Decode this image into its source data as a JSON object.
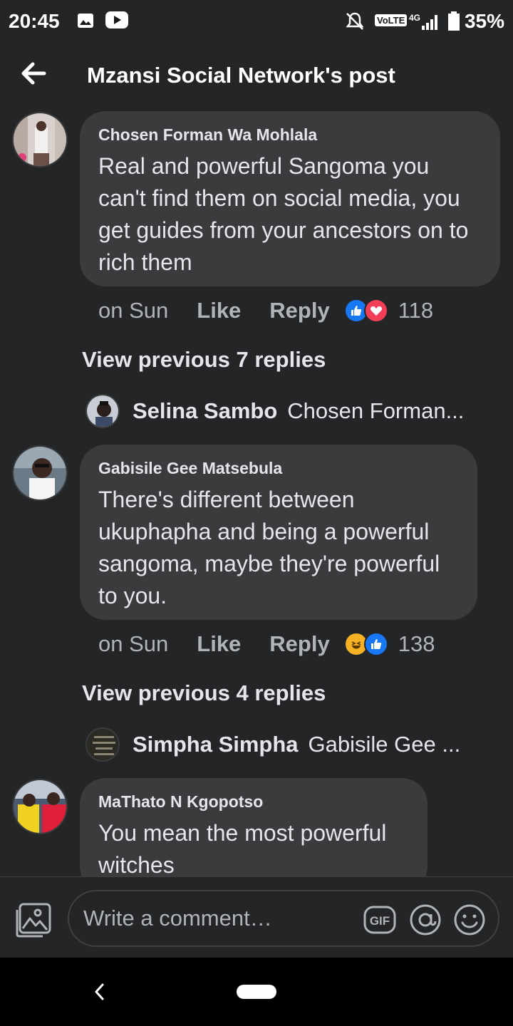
{
  "status_bar": {
    "time": "20:45",
    "battery": "35%",
    "volte": "VoLTE",
    "network": "4G",
    "icons": [
      "gallery-icon",
      "youtube-icon",
      "mute-icon",
      "volte-icon",
      "signal-icon",
      "battery-icon"
    ]
  },
  "header": {
    "title": "Mzansi Social Network's post",
    "back_icon": "arrow-left-icon"
  },
  "comments": [
    {
      "author": "Chosen Forman Wa Mohlala",
      "text": "Real and powerful Sangoma you can't find them on social media, you get guides from your ancestors on to rich them",
      "time": "on Sun",
      "like_label": "Like",
      "reply_label": "Reply",
      "reactions": [
        "like",
        "love"
      ],
      "reaction_count": "118",
      "view_previous": "View previous 7 replies",
      "latest_reply": {
        "name": "Selina Sambo",
        "snippet": "Chosen Forman..."
      }
    },
    {
      "author": "Gabisile Gee Matsebula",
      "text": "There's different between ukuphapha and being a powerful sangoma, maybe they're powerful to you.",
      "time": "on Sun",
      "like_label": "Like",
      "reply_label": "Reply",
      "reactions": [
        "haha",
        "like"
      ],
      "reaction_count": "138",
      "view_previous": "View previous 4 replies",
      "latest_reply": {
        "name": "Simpha Simpha",
        "snippet": "Gabisile Gee ..."
      }
    },
    {
      "author": "MaThato N Kgopotso",
      "text": "You mean the most powerful witches"
    }
  ],
  "composer": {
    "placeholder": "Write a comment…",
    "gif_label": "GIF",
    "icons": [
      "photo-icon",
      "gif-icon",
      "mention-icon",
      "emoji-icon"
    ]
  },
  "colors": {
    "background": "#242526",
    "bubble": "#3a3b3c",
    "like_blue": "#1877f2",
    "love_red": "#f33e58",
    "haha_yellow": "#f7b125"
  }
}
